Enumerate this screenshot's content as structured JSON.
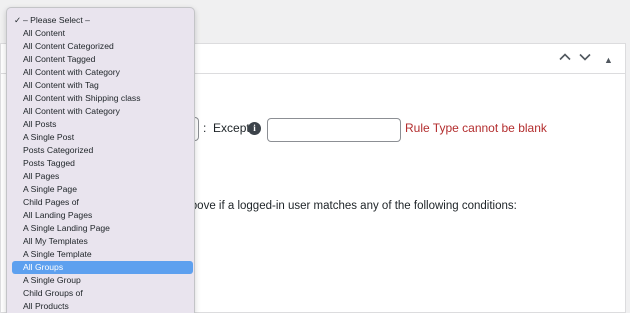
{
  "dropdown": {
    "check": "✓",
    "items": [
      "– Please Select –",
      "All Content",
      "All Content Categorized",
      "All Content Tagged",
      "All Content with Category",
      "All Content with Tag",
      "All Content with Shipping class",
      "All Content with Category",
      "All Posts",
      "A Single Post",
      "Posts Categorized",
      "Posts Tagged",
      "All Pages",
      "A Single Page",
      "Child Pages of",
      "All Landing Pages",
      "A Single Landing Page",
      "All My Templates",
      "A Single Template",
      "All Groups",
      "A Single Group",
      "Child Groups of",
      "All Products"
    ],
    "checked_index": 0,
    "highlighted_index": 19
  },
  "rule": {
    "separator": ":",
    "except_label": "Except",
    "info_icon": "i",
    "except_value": "",
    "error": "Rule Type cannot be blank"
  },
  "conditions": {
    "text": "t above if a logged-in user matches any of the following conditions:"
  },
  "header_icons": [
    "chevron-up-icon",
    "chevron-down-icon",
    "triangle-up-icon"
  ]
}
